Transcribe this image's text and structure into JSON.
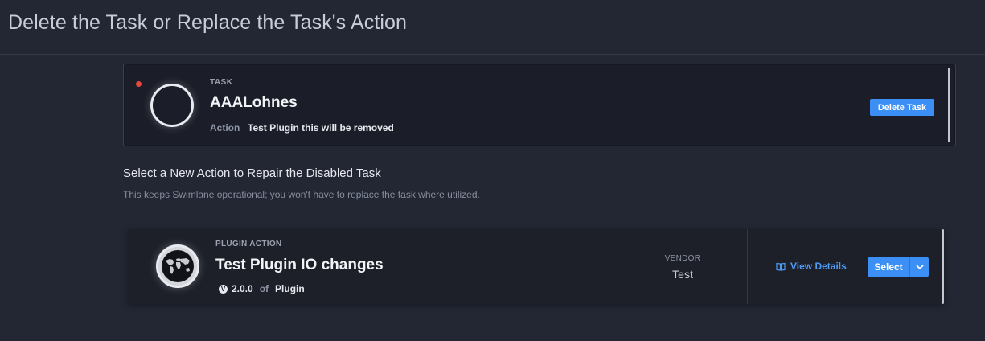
{
  "header": {
    "title": "Delete the Task or Replace the Task's Action"
  },
  "task": {
    "kicker": "TASK",
    "name": "AAALohnes",
    "action_label": "Action",
    "action_value": "Test Plugin this will be removed",
    "delete_label": "Delete Task",
    "status_color": "#e8453c"
  },
  "section": {
    "title": "Select a New Action to Repair the Disabled Task",
    "subtitle": "This keeps Swimlane operational; you won't have to replace the task where utilized."
  },
  "plugin": {
    "kicker": "PLUGIN ACTION",
    "name": "Test Plugin IO changes",
    "version_icon": "v-badge-icon",
    "version_icon_glyph": "V",
    "version": "2.0.0",
    "of_text": "of",
    "plugin_name": "Plugin",
    "vendor_label": "VENDOR",
    "vendor_value": "Test",
    "view_details_label": "View Details",
    "select_label": "Select",
    "logo_icon": "world-map-icon"
  },
  "colors": {
    "accent": "#3b8ff5",
    "link": "#4d9bf7",
    "background": "#232734"
  }
}
